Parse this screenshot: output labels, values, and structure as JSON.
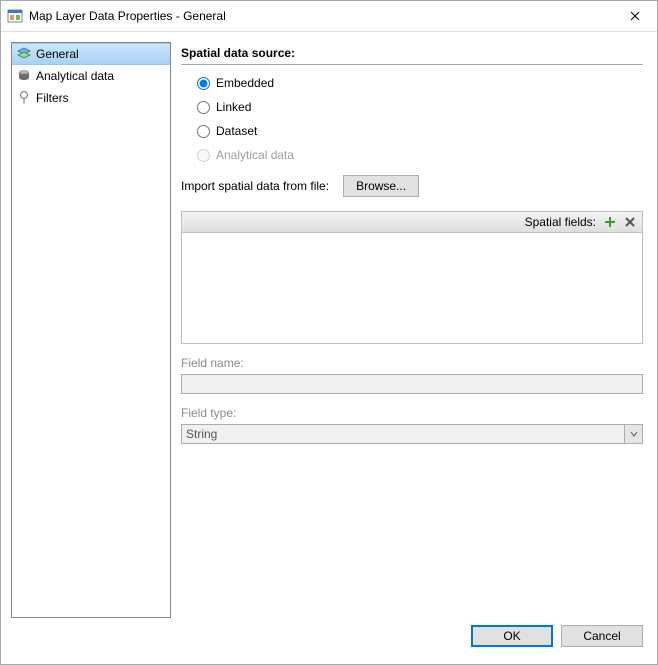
{
  "window": {
    "title": "Map Layer Data Properties - General"
  },
  "sidebar": {
    "items": [
      {
        "label": "General",
        "selected": true
      },
      {
        "label": "Analytical data",
        "selected": false
      },
      {
        "label": "Filters",
        "selected": false
      }
    ]
  },
  "main": {
    "section_heading": "Spatial data source:",
    "radios": {
      "embedded": "Embedded",
      "linked": "Linked",
      "dataset": "Dataset",
      "analytical": "Analytical data"
    },
    "selected_radio": "embedded",
    "import_label": "Import spatial data from file:",
    "browse_label": "Browse...",
    "spatial_fields_label": "Spatial fields:",
    "field_name_label": "Field name:",
    "field_name_value": "",
    "field_type_label": "Field type:",
    "field_type_value": "String"
  },
  "footer": {
    "ok": "OK",
    "cancel": "Cancel"
  }
}
